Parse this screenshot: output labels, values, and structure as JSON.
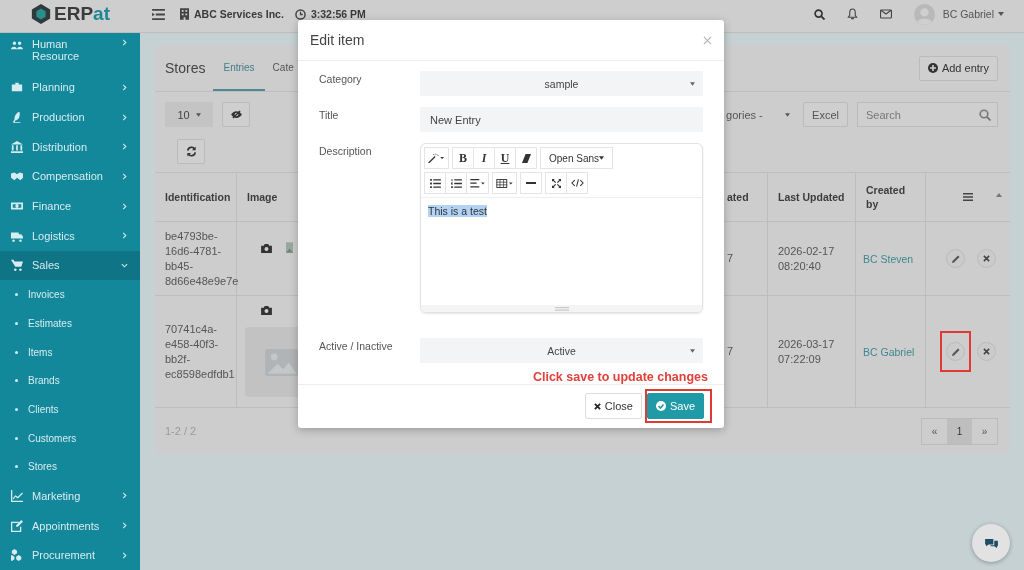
{
  "topbar": {
    "logo": [
      {
        "text": "ERP",
        "color": "#3b3b3b"
      },
      {
        "text": "at",
        "color": "#1e8796"
      }
    ],
    "company": "ABC Services Inc.",
    "time": "3:32:56 PM",
    "user": "BC Gabriel"
  },
  "sidebar": {
    "items": [
      {
        "label": "Human Resource",
        "expanded": false,
        "selected": false
      },
      {
        "label": "Planning",
        "expanded": false,
        "selected": false
      },
      {
        "label": "Production",
        "expanded": false,
        "selected": false
      },
      {
        "label": "Distribution",
        "expanded": false,
        "selected": false
      },
      {
        "label": "Compensation",
        "expanded": false,
        "selected": false
      },
      {
        "label": "Finance",
        "expanded": false,
        "selected": false
      },
      {
        "label": "Logistics",
        "expanded": false,
        "selected": false
      },
      {
        "label": "Sales",
        "expanded": true,
        "selected": true,
        "children": [
          "Invoices",
          "Estimates",
          "Items",
          "Brands",
          "Clients",
          "Customers",
          "Stores"
        ]
      },
      {
        "label": "Marketing",
        "expanded": false,
        "selected": false
      },
      {
        "label": "Appointments",
        "expanded": false,
        "selected": false
      },
      {
        "label": "Procurement",
        "expanded": false,
        "selected": false
      }
    ]
  },
  "page": {
    "title": "Stores",
    "tabs": [
      {
        "label": "Entries",
        "selected": true
      },
      {
        "label": "Cate",
        "selected": false
      }
    ],
    "add_button": "Add entry",
    "page_size": "10",
    "category_filter": "gories -",
    "excel_button": "Excel",
    "search": {
      "placeholder": "Search"
    },
    "table": {
      "columns": [
        "Identification",
        "Image",
        "ated",
        "Last Updated",
        "Created by"
      ],
      "rows": [
        {
          "identification": "be4793be-16d6-4781-bb45-8d66e48e9e7e",
          "image": {
            "kind": "broken"
          },
          "column_3": "7",
          "last_updated": "2026-02-17 08:20:40",
          "created_by": "BC Steven",
          "edit_highlighted": false
        },
        {
          "identification": "70741c4a-e458-40f3-bb2f-ec8598edfdb1",
          "image": {
            "kind": "placeholder"
          },
          "column_3": "7",
          "last_updated": "2026-03-17 07:22:09",
          "created_by": "BC Gabriel",
          "edit_highlighted": true
        }
      ]
    },
    "range": "1-2 / 2",
    "pagination": [
      {
        "label": "«",
        "selected": false
      },
      {
        "label": "1",
        "selected": true
      },
      {
        "label": "»",
        "selected": false
      }
    ]
  },
  "modal": {
    "title": "Edit item",
    "fields": [
      {
        "kind": "select",
        "label": "Category",
        "value": "sample"
      },
      {
        "kind": "input",
        "label": "Title",
        "value": "New Entry"
      },
      {
        "kind": "editor",
        "label": "Description",
        "value": "This is a test",
        "text_selected": true,
        "format_buttons": [
          "B",
          "I",
          "U"
        ],
        "font": "Open Sans"
      },
      {
        "kind": "select",
        "label": "Active / Inactive",
        "value": "Active"
      }
    ],
    "note": "Click save to update changes",
    "close_button": "Close",
    "save_button": "Save",
    "save_highlighted": true
  }
}
